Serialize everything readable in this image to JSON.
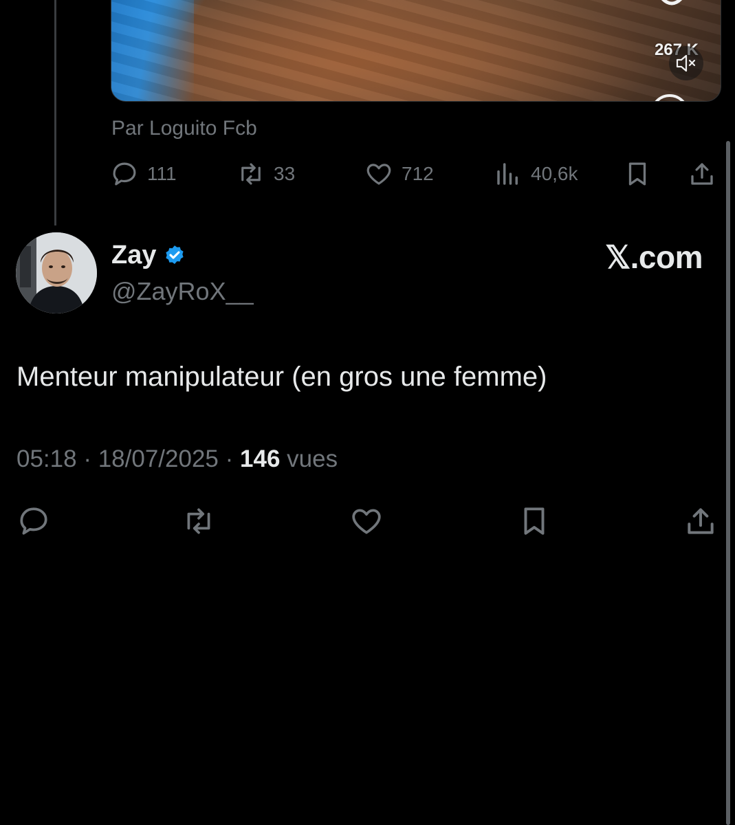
{
  "quoted_post": {
    "media": {
      "overlay_count": "267 K",
      "mute_icon": "mute-icon",
      "heart_icon": "heart-outline-icon"
    },
    "credit": "Par Loguito Fcb",
    "actions": {
      "replies": "111",
      "reposts": "33",
      "likes": "712",
      "views": "40,6k"
    }
  },
  "post": {
    "display_name": "Zay",
    "handle": "@ZayRoX__",
    "brand": "𝕏.com",
    "text": "Menteur manipulateur (en gros une femme)",
    "time": "05:18",
    "date": "18/07/2025",
    "views_count": "146",
    "views_label": "vues",
    "separator": "·"
  },
  "colors": {
    "background": "#000000",
    "text_primary": "#e7e9ea",
    "text_secondary": "#71767b",
    "verified": "#1d9bf0"
  }
}
